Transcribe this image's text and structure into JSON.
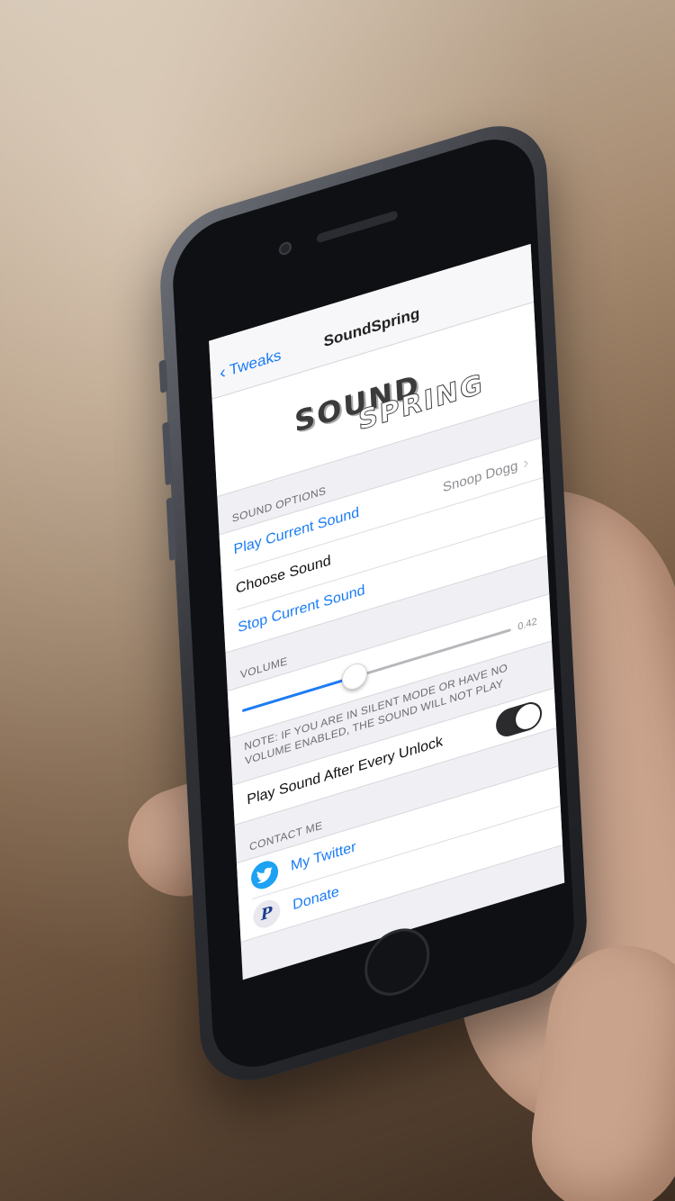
{
  "navbar": {
    "back_label": "Tweaks",
    "title": "SoundSpring"
  },
  "logo": {
    "word1": "SOUND",
    "word2": "SPRING"
  },
  "sound_options": {
    "header": "Sound Options",
    "items": [
      {
        "label": "Play Current Sound",
        "value": "Snoop Dogg"
      },
      {
        "label": "Choose Sound"
      },
      {
        "label": "Stop Current Sound"
      }
    ]
  },
  "volume": {
    "header": "Volume",
    "value": 0.42,
    "value_text": "0.42",
    "footer": "NOTE: If you are in silent mode or have no volume enabled, the sound will not play"
  },
  "unlock": {
    "label": "Play Sound After Every Unlock",
    "enabled": true
  },
  "contact": {
    "header": "Contact Me",
    "items": [
      {
        "label": "My Twitter",
        "icon": "twitter-icon"
      },
      {
        "label": "Donate",
        "icon": "paypal-icon"
      }
    ]
  },
  "colors": {
    "accent": "#1a7cf5",
    "twitter": "#1da1f2",
    "paypal": "#1b3d8f"
  }
}
